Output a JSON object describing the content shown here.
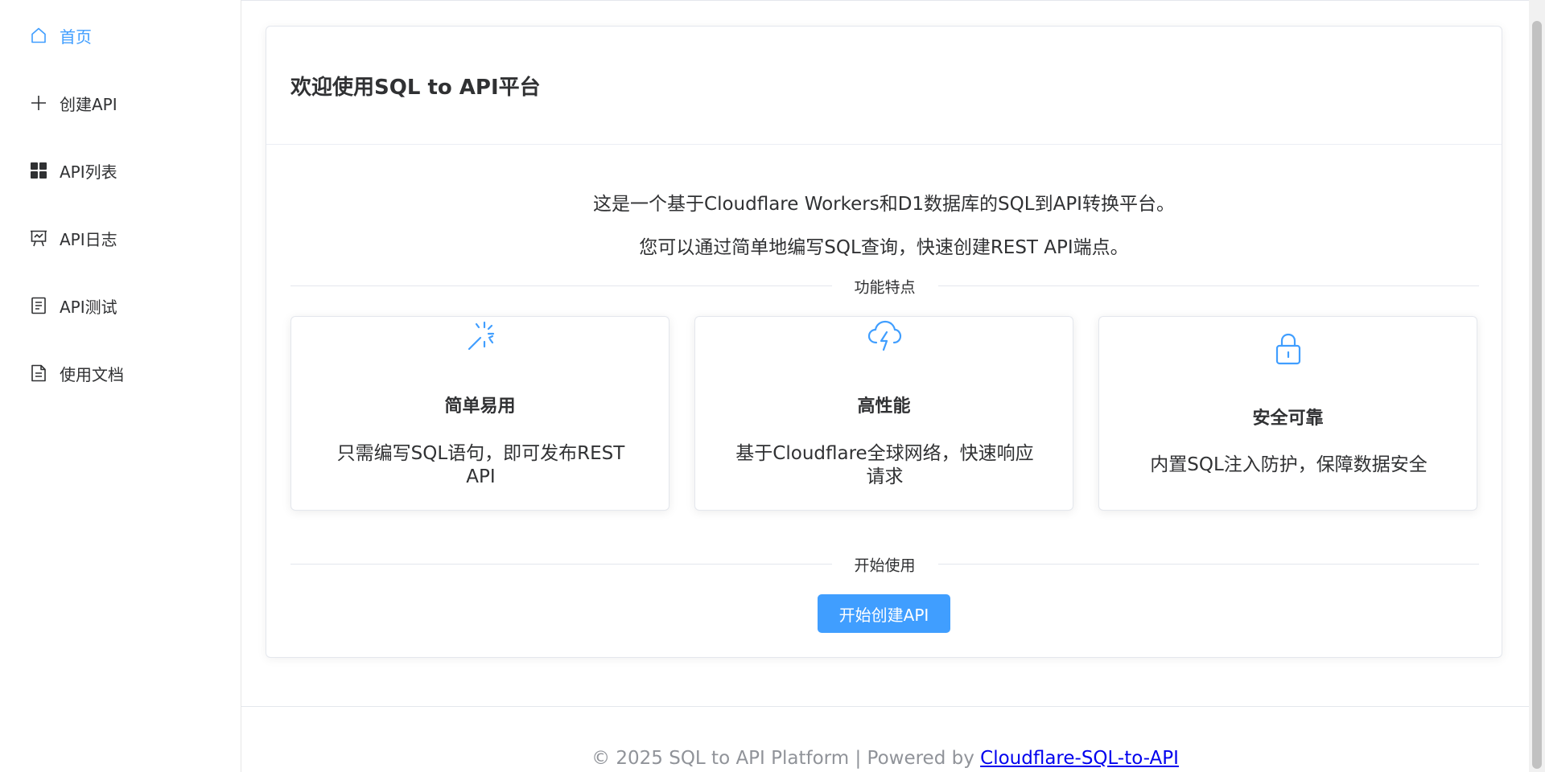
{
  "sidebar": {
    "items": [
      {
        "label": "首页",
        "icon": "home-icon",
        "active": true
      },
      {
        "label": "创建API",
        "icon": "plus-icon",
        "active": false
      },
      {
        "label": "API列表",
        "icon": "grid-icon",
        "active": false
      },
      {
        "label": "API日志",
        "icon": "presentation-icon",
        "active": false
      },
      {
        "label": "API测试",
        "icon": "document-icon",
        "active": false
      },
      {
        "label": "使用文档",
        "icon": "file-text-icon",
        "active": false
      }
    ]
  },
  "main": {
    "title": "欢迎使用SQL to API平台",
    "intro_line1": "这是一个基于Cloudflare Workers和D1数据库的SQL到API转换平台。",
    "intro_line2": "您可以通过简单地编写SQL查询，快速创建REST API端点。",
    "features_divider": "功能特点",
    "features": [
      {
        "icon": "magic-wand-icon",
        "title": "简单易用",
        "desc": "只需编写SQL语句，即可发布REST API"
      },
      {
        "icon": "cloud-lightning-icon",
        "title": "高性能",
        "desc": "基于Cloudflare全球网络，快速响应请求"
      },
      {
        "icon": "lock-icon",
        "title": "安全可靠",
        "desc": "内置SQL注入防护，保障数据安全"
      }
    ],
    "start_divider": "开始使用",
    "start_button": "开始创建API"
  },
  "footer": {
    "text": "© 2025 SQL to API Platform | Powered by ",
    "link": "Cloudflare-SQL-to-API"
  },
  "colors": {
    "primary": "#409eff",
    "text": "#303133",
    "muted": "#909399",
    "border": "#e4e7ed"
  }
}
